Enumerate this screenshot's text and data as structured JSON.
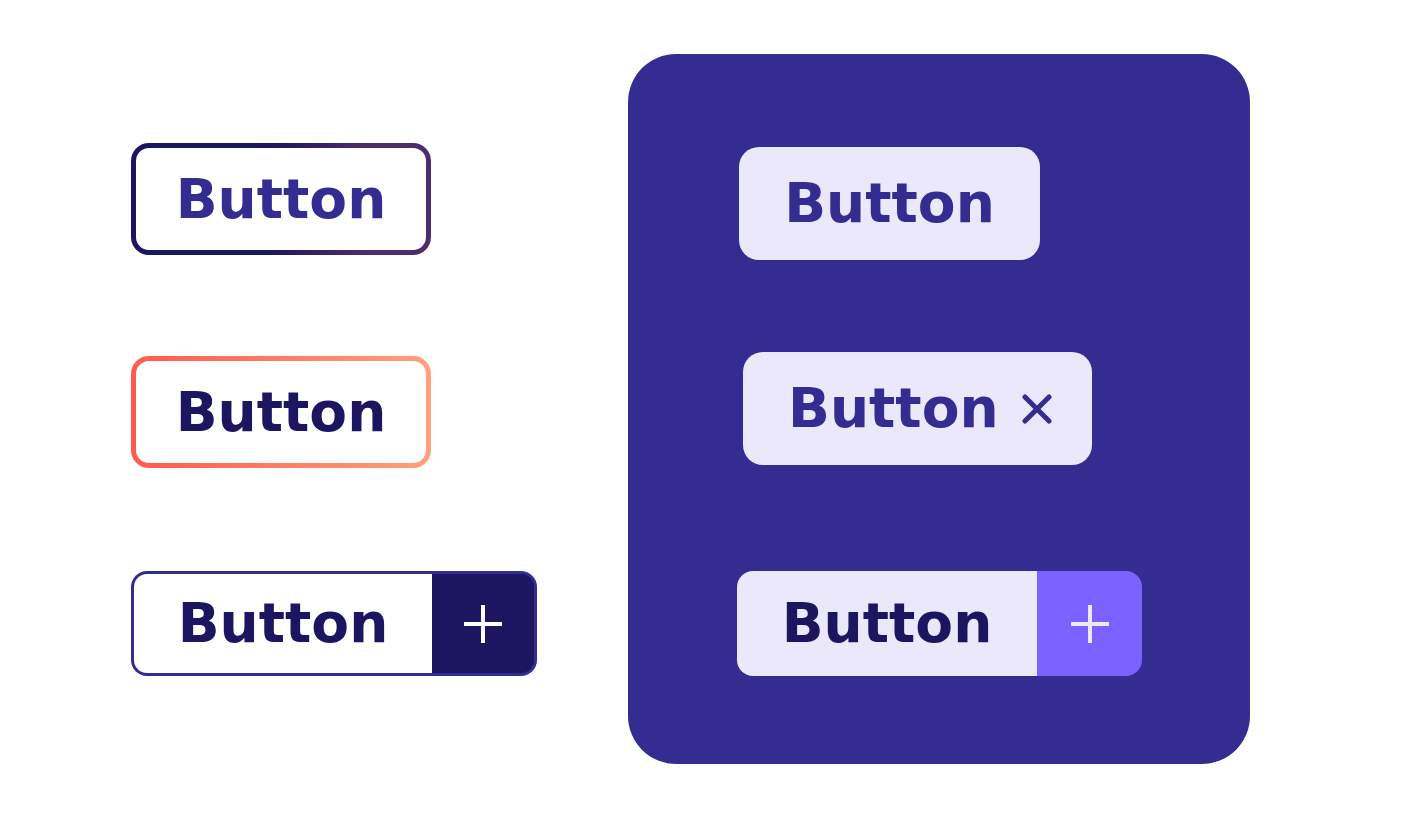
{
  "light_buttons": [
    {
      "label": "Button",
      "kind": "cool"
    },
    {
      "label": "Button",
      "kind": "warm"
    },
    {
      "label": "Button",
      "kind": "split"
    }
  ],
  "dark_panel": {
    "buttons": [
      {
        "label": "Button",
        "kind": "plain"
      },
      {
        "label": "Button",
        "kind": "removable"
      },
      {
        "label": "Button",
        "kind": "split"
      }
    ]
  }
}
